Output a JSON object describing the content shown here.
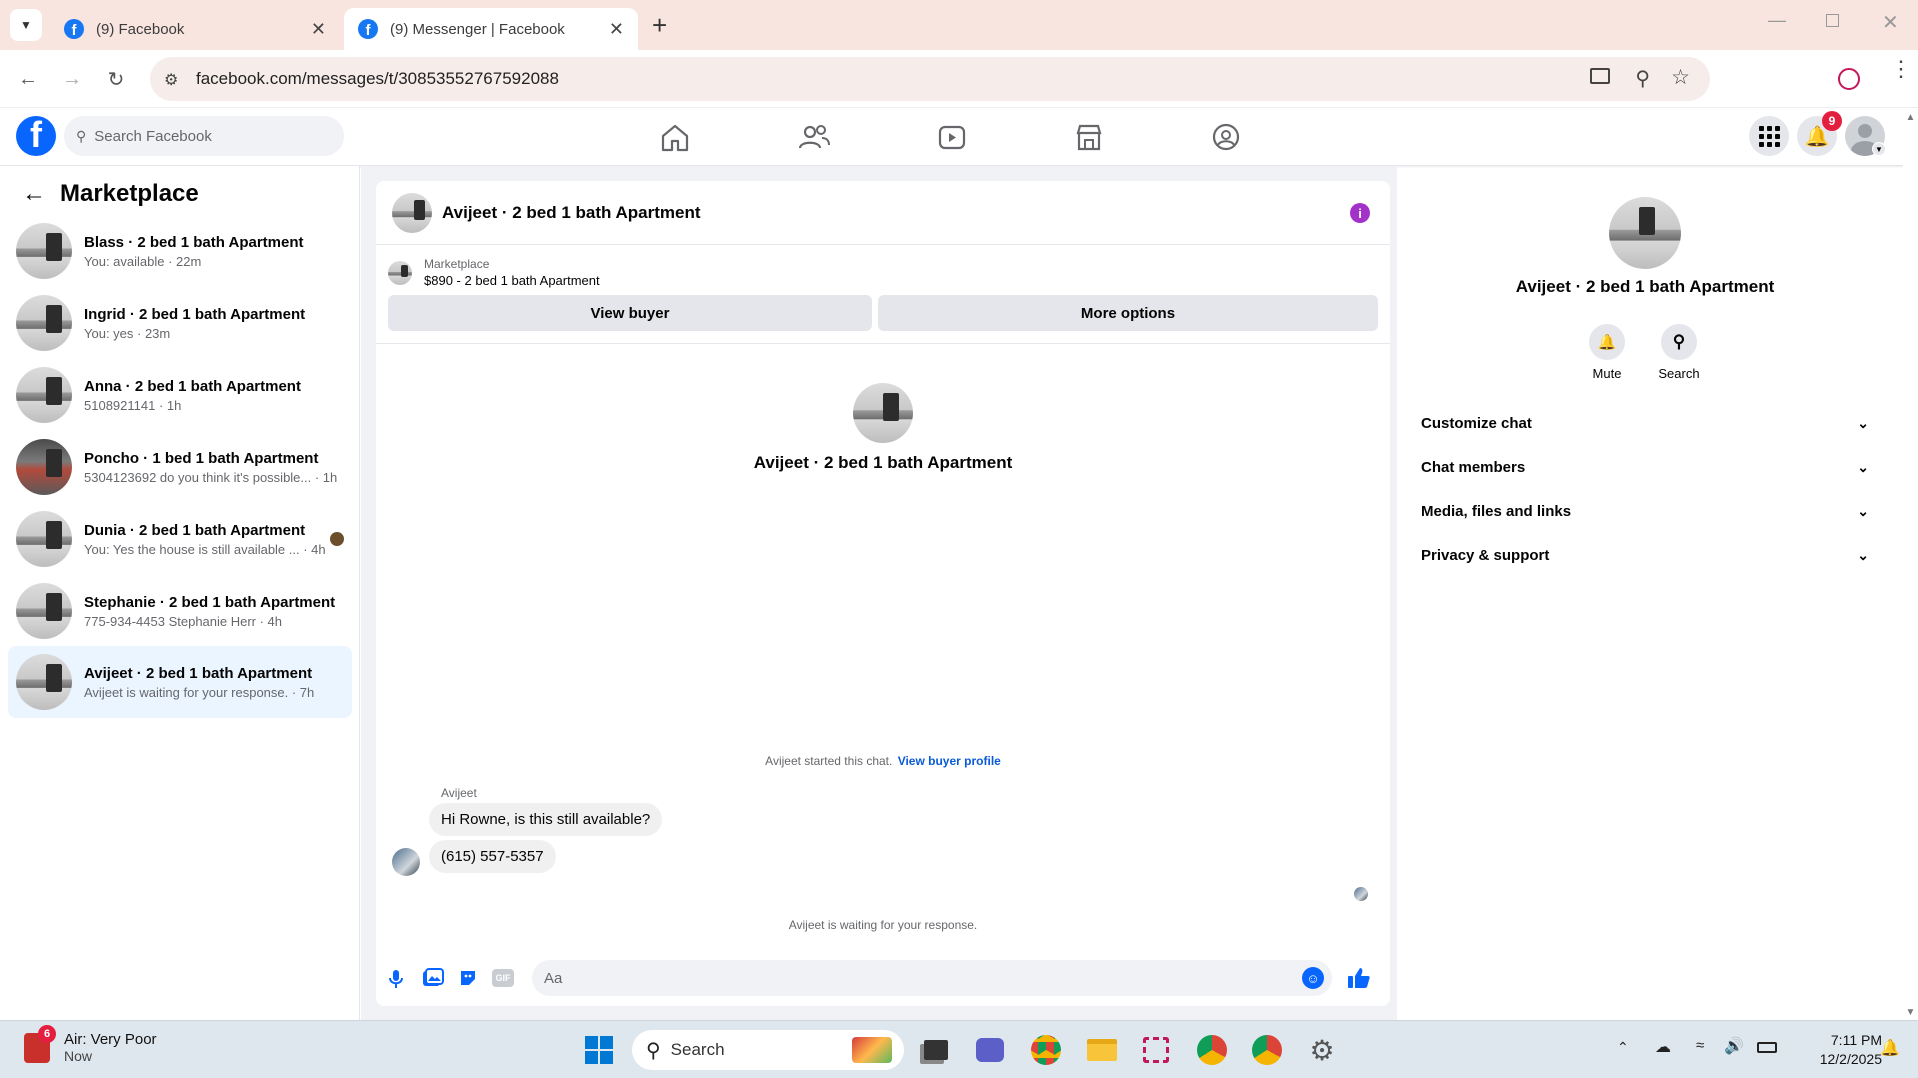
{
  "browser": {
    "tabs": [
      {
        "title": "(9) Facebook",
        "active": false
      },
      {
        "title": "(9) Messenger | Facebook",
        "active": true
      }
    ],
    "url": "facebook.com/messages/t/30853552767592088"
  },
  "fb": {
    "search_placeholder": "Search Facebook",
    "notification_count": "9"
  },
  "left": {
    "title": "Marketplace",
    "conversations": [
      {
        "name": "Blass · 2 bed 1 bath Apartment",
        "preview": "You: available · 22m"
      },
      {
        "name": "Ingrid · 2 bed 1 bath Apartment",
        "preview": "You: yes · 23m"
      },
      {
        "name": "Anna · 2 bed 1 bath Apartment",
        "preview": "5108921141 · 1h"
      },
      {
        "name": "Poncho · 1 bed 1 bath Apartment",
        "preview": "5304123692 do you think it's possible... · 1h"
      },
      {
        "name": "Dunia · 2 bed 1 bath Apartment",
        "preview": "You: Yes the house is still available ... · 4h"
      },
      {
        "name": "Stephanie · 2 bed 1 bath Apartment",
        "preview": "775-934-4453 Stephanie Herr · 4h"
      },
      {
        "name": "Avijeet · 2 bed 1 bath Apartment",
        "preview": "Avijeet is waiting for your response. · 7h"
      }
    ]
  },
  "chat": {
    "header_title": "Avijeet · 2 bed 1 bath Apartment",
    "listing_source": "Marketplace",
    "listing_title": "$890 - 2 bed 1 bath Apartment",
    "view_buyer": "View buyer",
    "more_options": "More options",
    "intro_name": "Avijeet · 2 bed 1 bath Apartment",
    "started_text": "Avijeet started this chat.",
    "buyer_profile_link": "View buyer profile",
    "sender": "Avijeet",
    "messages": [
      "Hi Rowne, is this still available?",
      "(615) 557-5357"
    ],
    "waiting_text": "Avijeet is waiting for your response.",
    "input_placeholder": "Aa"
  },
  "right": {
    "name": "Avijeet · 2 bed 1 bath Apartment",
    "mute": "Mute",
    "search": "Search",
    "sections": [
      "Customize chat",
      "Chat members",
      "Media, files and links",
      "Privacy & support"
    ]
  },
  "taskbar": {
    "weather_badge": "6",
    "weather_title": "Air: Very Poor",
    "weather_sub": "Now",
    "search": "Search",
    "time": "7:11 PM",
    "date": "12/2/2025"
  },
  "colors": {
    "fb_blue": "#0866ff",
    "active_conv": "#ebf5ff",
    "info_purple": "#a333c8",
    "badge_red": "#e41e3f",
    "tabstrip": "#f8e5e0"
  }
}
